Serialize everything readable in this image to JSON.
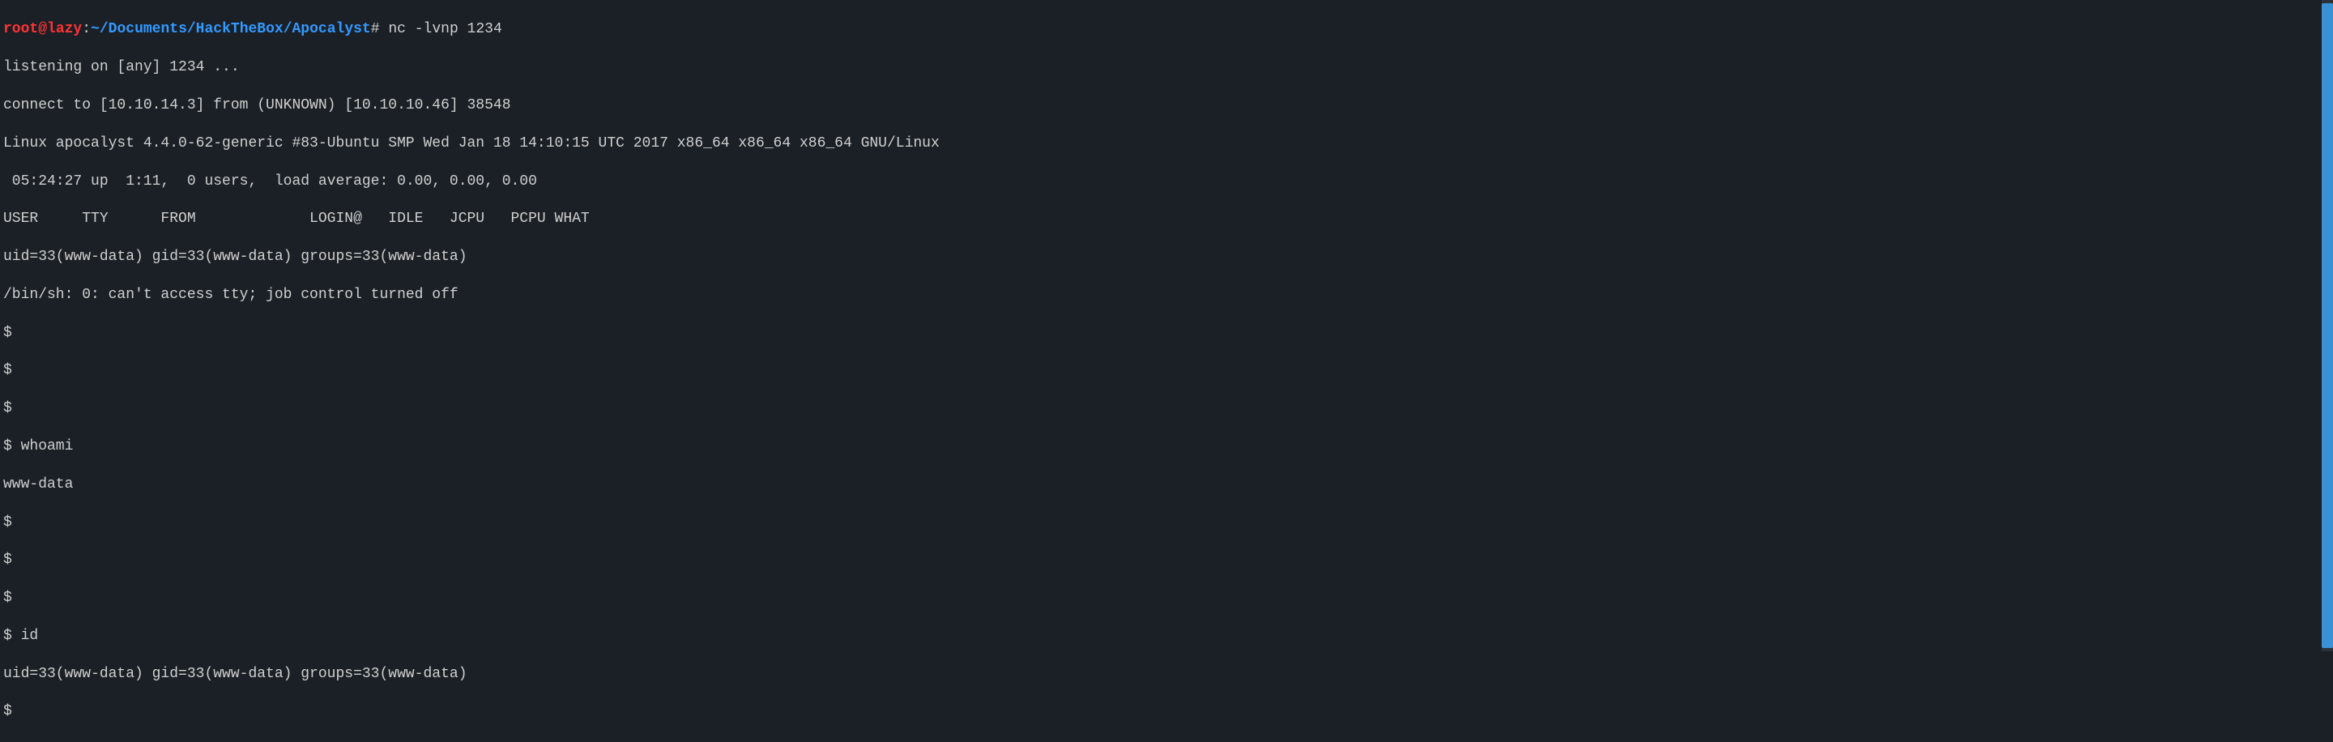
{
  "prompt": {
    "user": "root",
    "at": "@",
    "host": "lazy",
    "colon": ":",
    "path": "~/Documents/HackTheBox/Apocalyst",
    "hash": "#",
    "command": " nc -lvnp 1234"
  },
  "output": {
    "l1": "listening on [any] 1234 ...",
    "l2": "connect to [10.10.14.3] from (UNKNOWN) [10.10.10.46] 38548",
    "l3": "Linux apocalyst 4.4.0-62-generic #83-Ubuntu SMP Wed Jan 18 14:10:15 UTC 2017 x86_64 x86_64 x86_64 GNU/Linux",
    "l4": " 05:24:27 up  1:11,  0 users,  load average: 0.00, 0.00, 0.00",
    "l5": "USER     TTY      FROM             LOGIN@   IDLE   JCPU   PCPU WHAT",
    "l6": "uid=33(www-data) gid=33(www-data) groups=33(www-data)",
    "l7": "/bin/sh: 0: can't access tty; job control turned off",
    "l8": "$ ",
    "l9": "$ ",
    "l10": "$ ",
    "l11": "$ whoami",
    "l12": "www-data",
    "l13": "$ ",
    "l14": "$ ",
    "l15": "$ ",
    "l16": "$ id",
    "l17": "uid=33(www-data) gid=33(www-data) groups=33(www-data)",
    "l18": "$ "
  }
}
